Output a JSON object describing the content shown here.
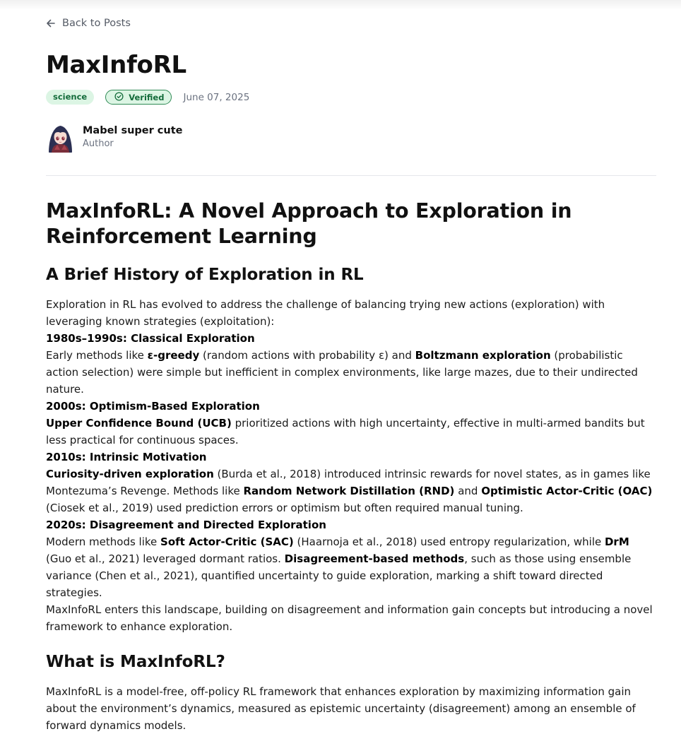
{
  "nav": {
    "back_label": "Back to Posts"
  },
  "post": {
    "title": "MaxInfoRL",
    "tag": "science",
    "verified_label": "Verified",
    "date": "June 07, 2025",
    "author_name": "Mabel super cute",
    "author_role": "Author"
  },
  "article": {
    "h1": "MaxInfoRL: A Novel Approach to Exploration in Reinforcement Learning",
    "section1_title": "A Brief History of Exploration in RL",
    "intro": "Exploration in RL has evolved to address the challenge of balancing trying new actions (exploration) with leveraging known strategies (exploitation):",
    "era1": {
      "heading": "1980s–1990s: Classical Exploration",
      "t1": "Early methods like ",
      "b1": "ε-greedy",
      "t2": " (random actions with probability ε) and ",
      "b2": "Boltzmann exploration",
      "t3": " (probabilistic action selection) were simple but inefficient in complex environments, like large mazes, due to their undirected nature."
    },
    "era2": {
      "heading": "2000s: Optimism-Based Exploration",
      "b1": "Upper Confidence Bound (UCB)",
      "t1": " prioritized actions with high uncertainty, effective in multi-armed bandits but less practical for continuous spaces."
    },
    "era3": {
      "heading": "2010s: Intrinsic Motivation",
      "b1": "Curiosity-driven exploration",
      "t1": " (Burda et al., 2018) introduced intrinsic rewards for novel states, as in games like Montezuma’s Revenge. Methods like ",
      "b2": "Random Network Distillation (RND)",
      "t2": " and ",
      "b3": "Optimistic Actor-Critic (OAC)",
      "t3": " (Ciosek et al., 2019) used prediction errors or optimism but often required manual tuning."
    },
    "era4": {
      "heading": "2020s: Disagreement and Directed Exploration",
      "t1": "Modern methods like ",
      "b1": "Soft Actor-Critic (SAC)",
      "t2": " (Haarnoja et al., 2018) used entropy regularization, while ",
      "b2": "DrM",
      "t3": " (Guo et al., 2021) leveraged dormant ratios. ",
      "b3": "Disagreement-based methods",
      "t4": ", such as those using ensemble variance (Chen et al., 2021), quantified uncertainty to guide exploration, marking a shift toward directed strategies."
    },
    "closing": "MaxInfoRL enters this landscape, building on disagreement and information gain concepts but introducing a novel framework to enhance exploration.",
    "section2_title": "What is MaxInfoRL?",
    "section2_body": "MaxInfoRL is a model-free, off-policy RL framework that enhances exploration by maximizing information gain about the environment’s dynamics, measured as epistemic uncertainty (disagreement) among an ensemble of forward dynamics models."
  },
  "icons": {
    "back": "arrow-left-icon",
    "verified": "check-circle-icon"
  },
  "colors": {
    "tag_bg": "#dcf5e4",
    "tag_text": "#146c3b",
    "muted_text": "#6b7280"
  }
}
